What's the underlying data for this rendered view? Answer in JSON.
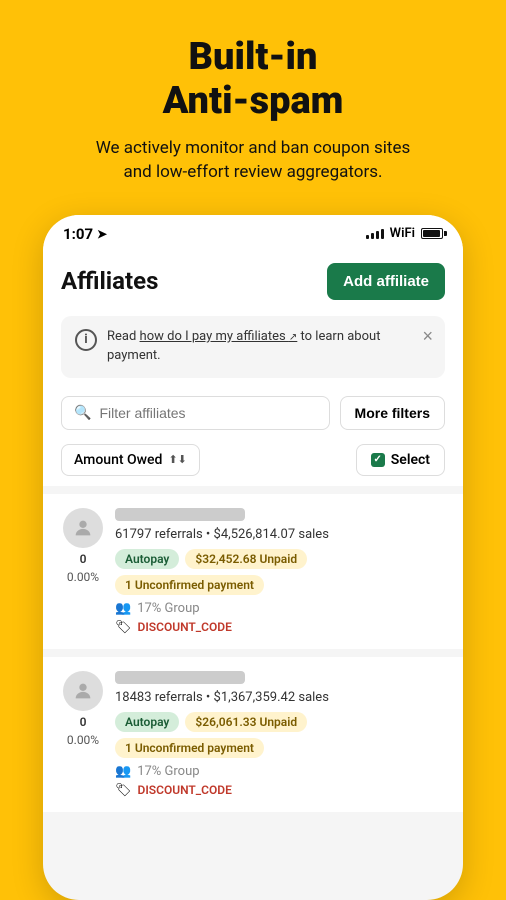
{
  "hero": {
    "title": "Built-in\nAnti-spam",
    "subtitle": "We actively monitor and ban coupon sites\nand low-effort review aggregators."
  },
  "status_bar": {
    "time": "1:07",
    "signal_bars": [
      4,
      6,
      8,
      10,
      12
    ],
    "wifi": "WiFi",
    "battery": "Battery"
  },
  "header": {
    "title": "Affiliates",
    "add_button": "Add affiliate"
  },
  "info_banner": {
    "text_before": "Read ",
    "link_text": "how do I pay my affiliates",
    "text_after": " to learn about payment."
  },
  "filter": {
    "placeholder": "Filter affiliates",
    "more_filters": "More filters"
  },
  "sort": {
    "label": "Amount Owed",
    "select_label": "Select"
  },
  "affiliates": [
    {
      "count": "0",
      "percent": "0.00%",
      "stats": "61797 referrals • $4,526,814.07 sales",
      "badges": [
        "Autopay",
        "$32,452.68 Unpaid",
        "1 Unconfirmed payment"
      ],
      "group": "17% Group",
      "code": "DISCOUNT_CODE"
    },
    {
      "count": "0",
      "percent": "0.00%",
      "stats": "18483 referrals • $1,367,359.42 sales",
      "badges": [
        "Autopay",
        "$26,061.33 Unpaid",
        "1 Unconfirmed payment"
      ],
      "group": "17% Group",
      "code": "DISCOUNT_CODE"
    }
  ]
}
